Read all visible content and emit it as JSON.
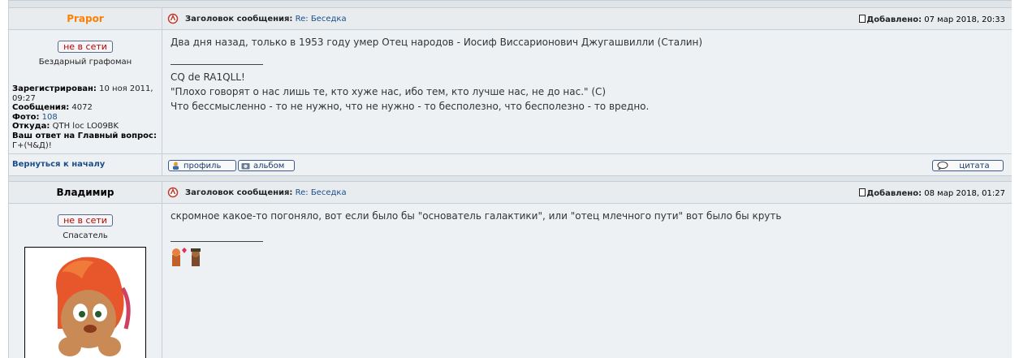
{
  "posts": [
    {
      "author": "Prapor",
      "status": "не в сети",
      "rank": "Бездарный графоман",
      "subject_label": "Заголовок сообщения:",
      "subject": "Re: Беседка",
      "added_label": "Добавлено:",
      "added": "07 мар 2018, 20:33",
      "details": {
        "registered_label": "Зарегистрирован:",
        "registered": "10 ноя 2011, 09:27",
        "messages_label": "Сообщения:",
        "messages": "4072",
        "photo_label": "Фото:",
        "photo": "108",
        "from_label": "Откуда:",
        "from": "QTH loc LO09BK",
        "answer_label": "Ваш ответ на Главный вопрос:",
        "answer": "Г+(Ч&Д)!"
      },
      "text": "Два дня назад, только в 1953 году умер Отец народов - Иосиф Виссарионович Джугашвилли (Сталин)",
      "signature": [
        "CQ de RA1QLL!",
        "\"Плохо говорят о нас лишь те, кто хуже нас, ибо тем, кто лучше нас, не до нас.\" (С)",
        "Что бессмысленно - то не нужно, что не нужно - то бесполезно, что бесполезно - то вредно."
      ],
      "back_link": "Вернуться к началу",
      "btn_profile": "профиль",
      "btn_album": "альбом",
      "btn_quote": "цитата"
    },
    {
      "author": "Владимир",
      "status": "не в сети",
      "rank": "Спасатель",
      "subject_label": "Заголовок сообщения:",
      "subject": "Re: Беседка",
      "added_label": "Добавлено:",
      "added": "08 мар 2018, 01:27",
      "text": "скромное какое-то погоняло, вот если было бы \"основатель галактики\", или \"отец млечного пути\" вот было бы круть"
    }
  ]
}
